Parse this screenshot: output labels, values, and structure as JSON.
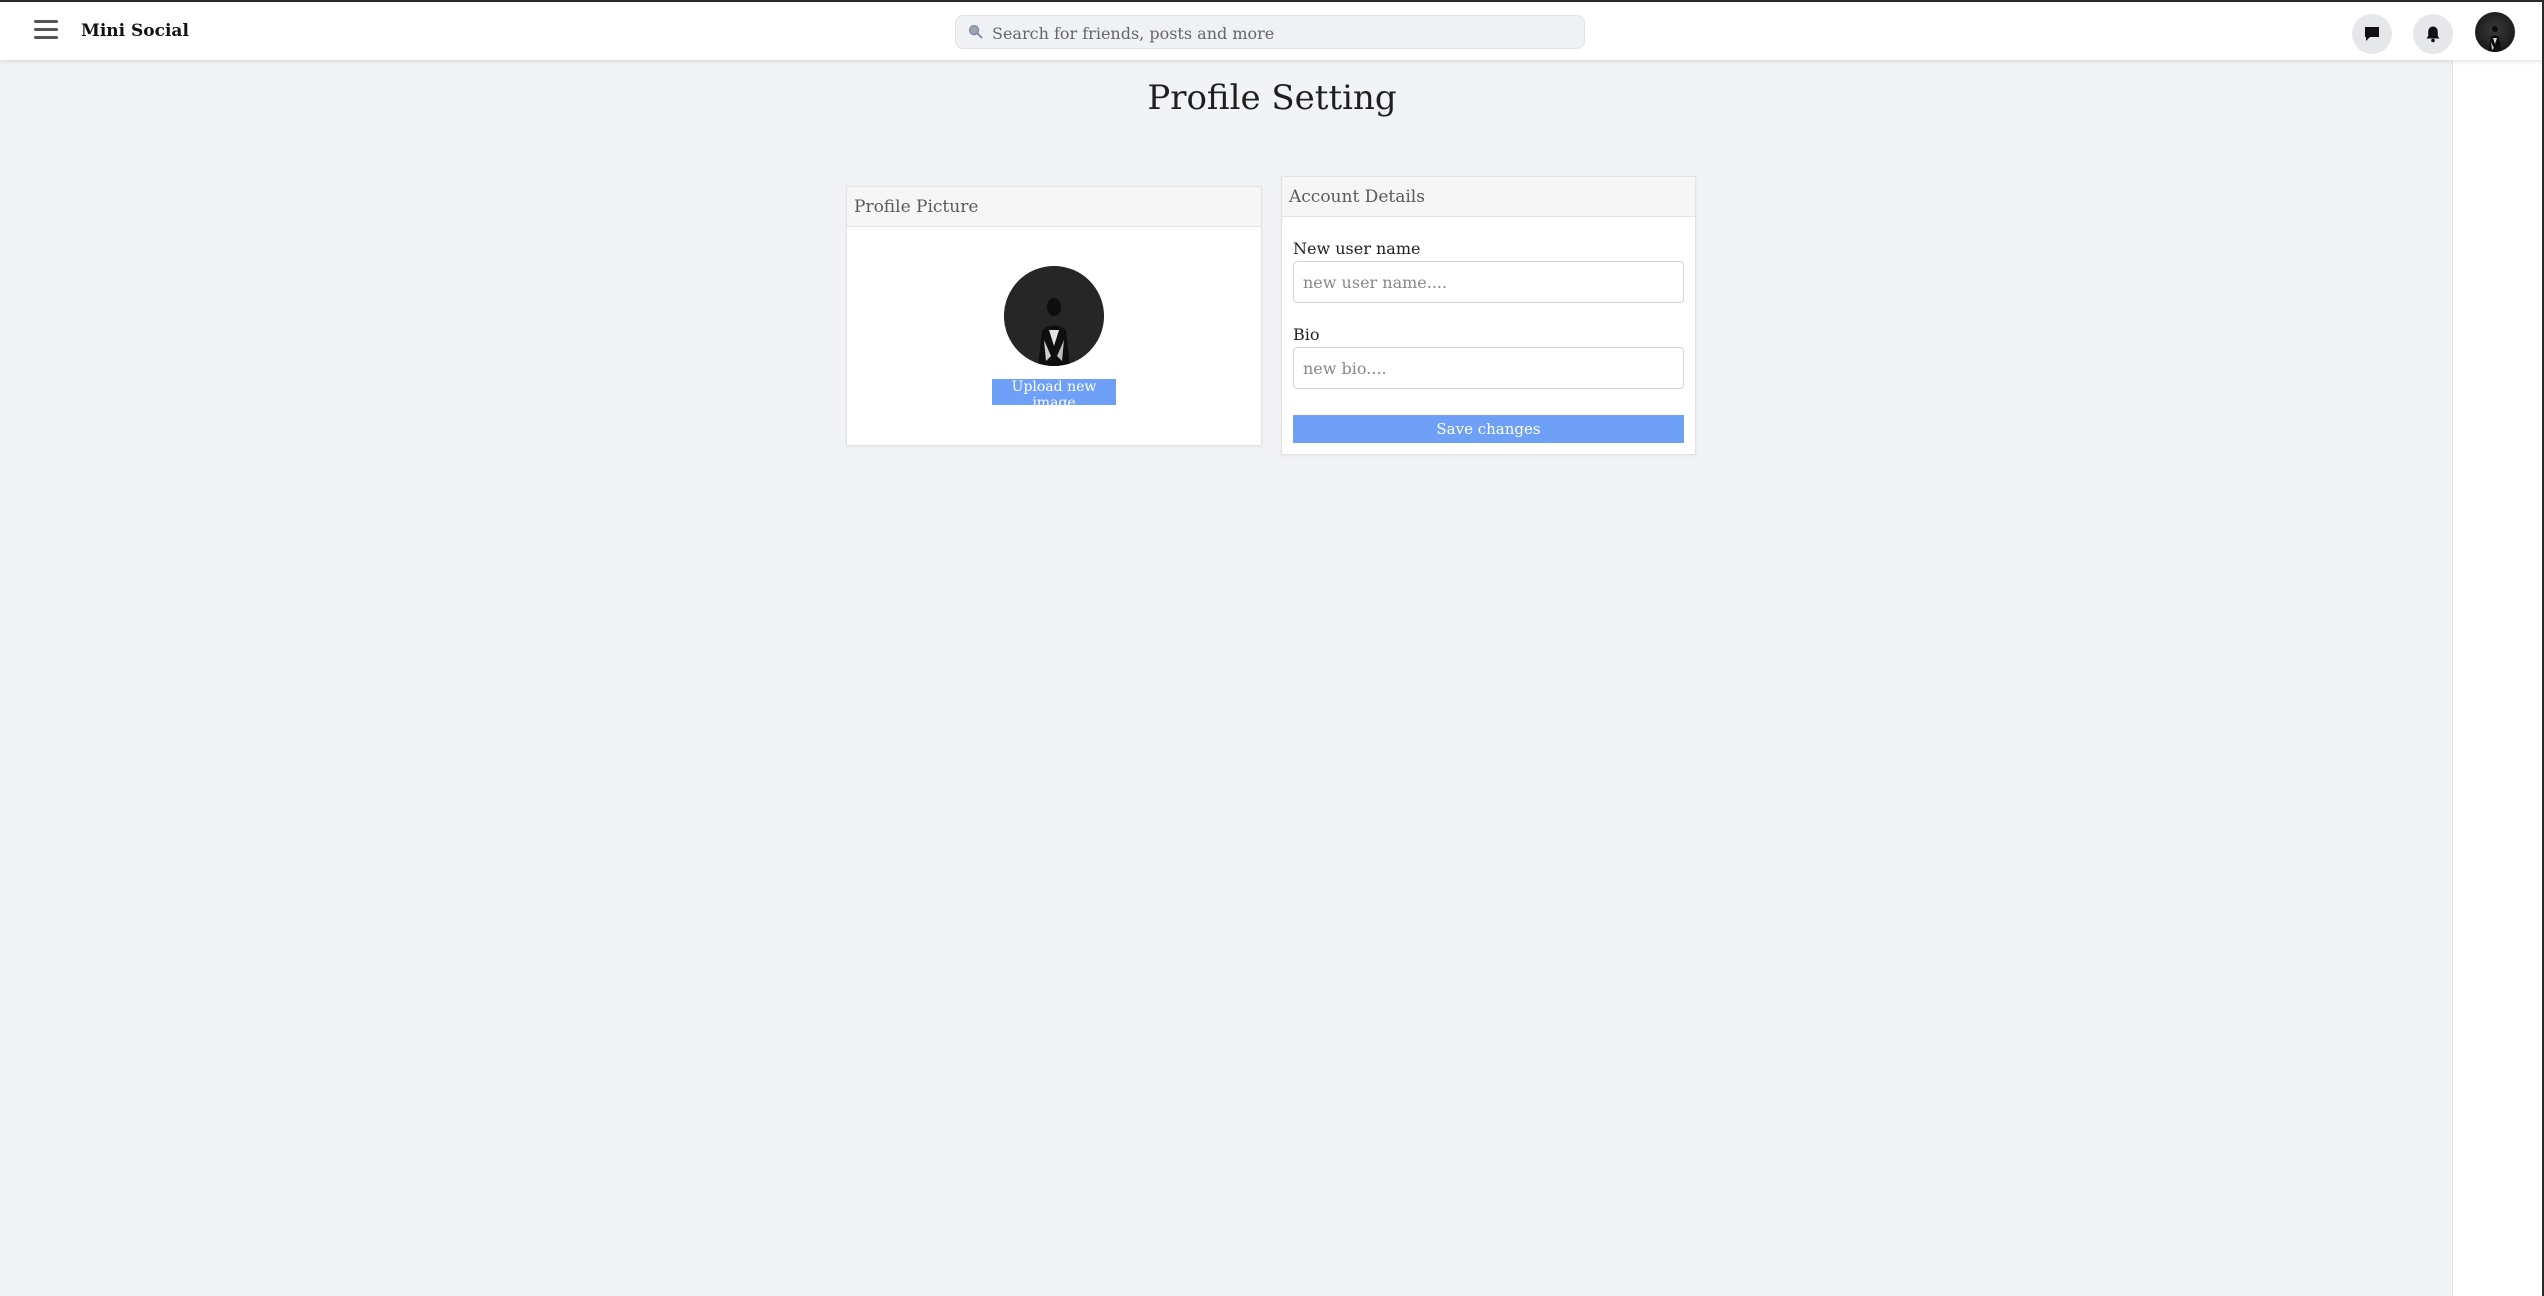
{
  "header": {
    "brand": "Mini Social",
    "search_placeholder": "Search for friends, posts and more",
    "icons": {
      "menu": "menu-icon",
      "search": "search-icon",
      "chat": "chat-icon",
      "notifications": "bell-icon",
      "avatar": "user-avatar"
    }
  },
  "page": {
    "title": "Profile Setting"
  },
  "profile_picture": {
    "title": "Profile Picture",
    "upload_label": "Upload new image"
  },
  "account_details": {
    "title": "Account Details",
    "username_label": "New user name",
    "username_placeholder": "new user name....",
    "bio_label": "Bio",
    "bio_placeholder": "new bio....",
    "save_label": "Save changes"
  },
  "colors": {
    "accent": "#6fa0f7",
    "page_background": "#f2f3f6",
    "card_header": "#f6f6f6"
  }
}
